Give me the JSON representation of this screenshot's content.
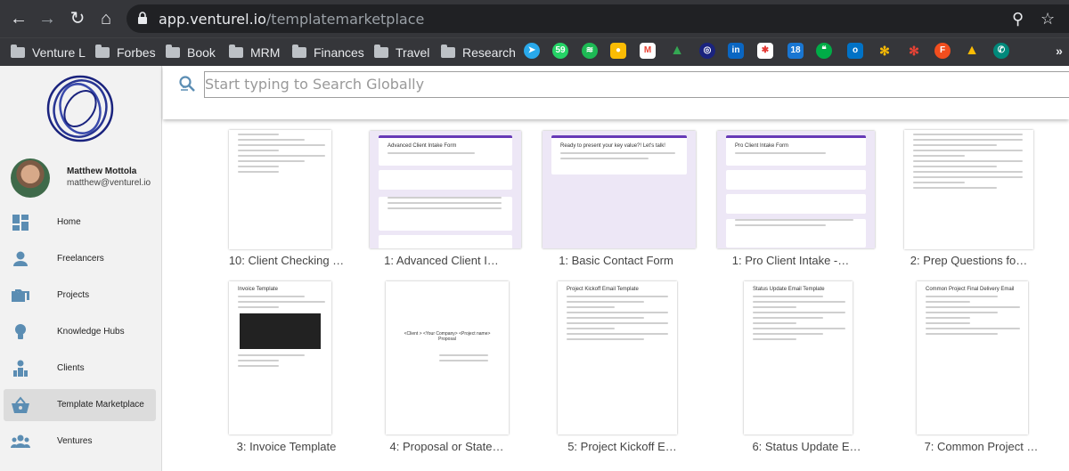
{
  "browser": {
    "url_host": "app.venturel.io",
    "url_path": "/templatemarketplace",
    "bookmarks": [
      "Venture L",
      "Forbes",
      "Book",
      "MRM",
      "Finances",
      "Travel",
      "Research"
    ]
  },
  "sidebar": {
    "user": {
      "name": "Matthew Mottola",
      "email": "matthew@venturel.io"
    },
    "items": [
      {
        "label": "Home",
        "icon": "dashboard-icon",
        "active": false
      },
      {
        "label": "Freelancers",
        "icon": "person-icon",
        "active": false
      },
      {
        "label": "Projects",
        "icon": "folders-icon",
        "active": false
      },
      {
        "label": "Knowledge Hubs",
        "icon": "lightbulb-icon",
        "active": false
      },
      {
        "label": "Clients",
        "icon": "clients-icon",
        "active": false
      },
      {
        "label": "Template Marketplace",
        "icon": "basket-icon",
        "active": true
      },
      {
        "label": "Ventures",
        "icon": "group-icon",
        "active": false
      }
    ]
  },
  "search": {
    "placeholder": "Start typing to Search Globally"
  },
  "templates": [
    {
      "caption": "10: Client Checking …",
      "kind": "doc"
    },
    {
      "caption": "1: Advanced Client I…",
      "kind": "form",
      "title": "Advanced Client Intake Form"
    },
    {
      "caption": "1: Basic Contact Form",
      "kind": "form",
      "title": "Ready to present your key value?! Let's talk!"
    },
    {
      "caption": "1: Pro Client Intake -…",
      "kind": "form",
      "title": "Pro Client Intake Form"
    },
    {
      "caption": "2: Prep Questions fo…",
      "kind": "doc"
    },
    {
      "caption": "3: Invoice Template",
      "kind": "doc",
      "title": "Invoice Template"
    },
    {
      "caption": "4: Proposal or State…",
      "kind": "doc",
      "title": "<Client > <Your Company> <Project name> Proposal"
    },
    {
      "caption": "5: Project Kickoff E…",
      "kind": "doc",
      "title": "Project Kickoff Email Template"
    },
    {
      "caption": "6: Status Update E…",
      "kind": "doc",
      "title": "Status Update Email Template"
    },
    {
      "caption": "7: Common Project …",
      "kind": "doc",
      "title": "Common Project Final Delivery Email"
    }
  ],
  "colors": {
    "accent": "#3949ab",
    "form_purple": "#673ab7"
  }
}
